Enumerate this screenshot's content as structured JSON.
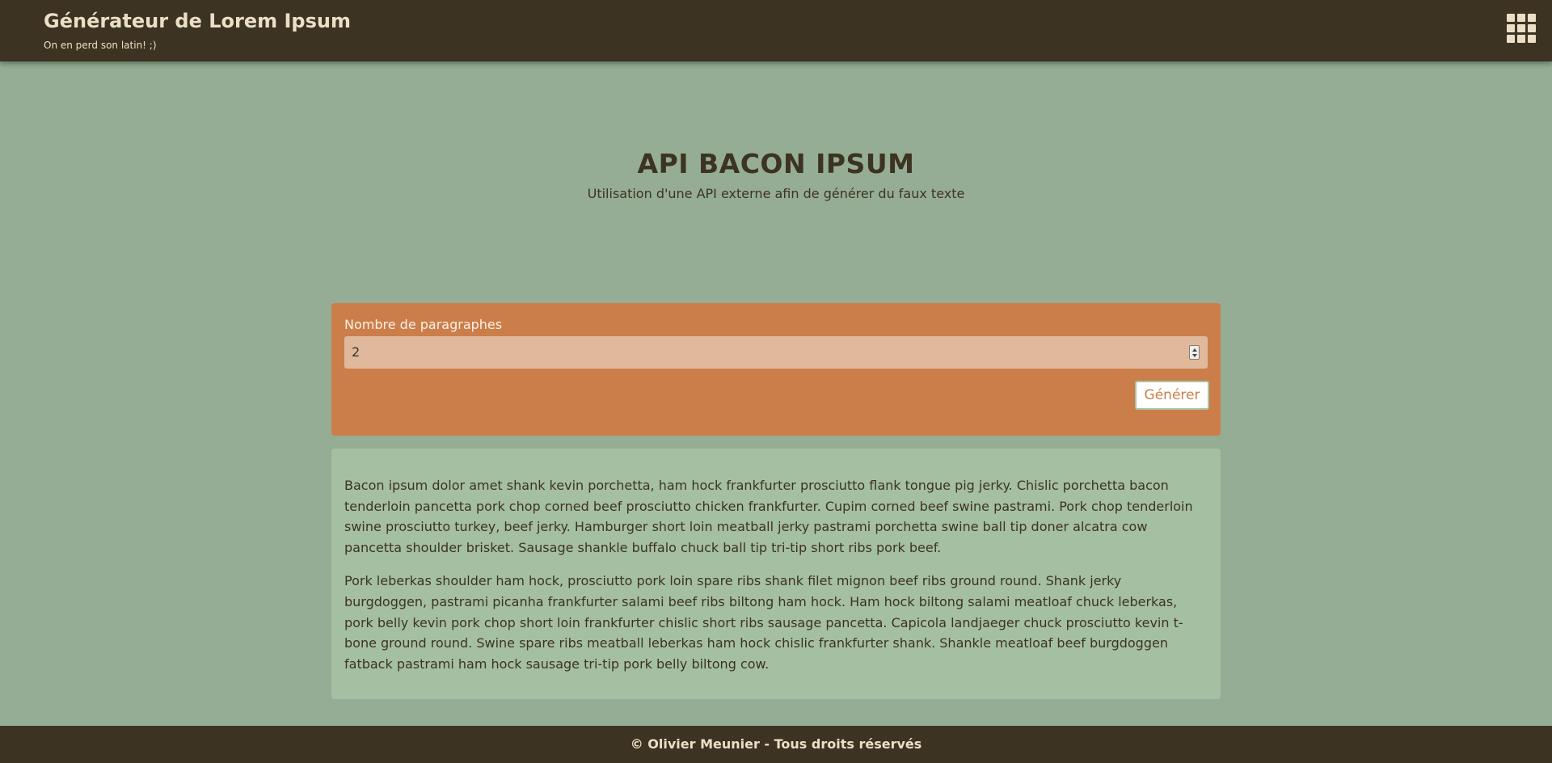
{
  "header": {
    "title": "Générateur de Lorem Ipsum",
    "subtitle": "On en perd son latin! ;)",
    "menu_icon": "grid-apps-icon"
  },
  "hero": {
    "title": "API BACON IPSUM",
    "subtitle": "Utilisation d'une API externe afin de générer du faux texte"
  },
  "form": {
    "label": "Nombre de paragraphes",
    "value": "2",
    "button_label": "Générer"
  },
  "result": {
    "paragraphs": [
      "Bacon ipsum dolor amet shank kevin porchetta, ham hock frankfurter prosciutto flank tongue pig jerky. Chislic porchetta bacon tenderloin pancetta pork chop corned beef prosciutto chicken frankfurter. Cupim corned beef swine pastrami. Pork chop tenderloin swine prosciutto turkey, beef jerky. Hamburger short loin meatball jerky pastrami porchetta swine ball tip doner alcatra cow pancetta shoulder brisket. Sausage shankle buffalo chuck ball tip tri-tip short ribs pork beef.",
      "Pork leberkas shoulder ham hock, prosciutto pork loin spare ribs shank filet mignon beef ribs ground round. Shank jerky burgdoggen, pastrami picanha frankfurter salami beef ribs biltong ham hock. Ham hock biltong salami meatloaf chuck leberkas, pork belly kevin pork chop short loin frankfurter chislic short ribs sausage pancetta. Capicola landjaeger chuck prosciutto kevin t-bone ground round. Swine spare ribs meatball leberkas ham hock chislic frankfurter shank. Shankle meatloaf beef burgdoggen fatback pastrami ham hock sausage tri-tip pork belly biltong cow."
    ]
  },
  "footer": {
    "text": "© Olivier Meunier - Tous droits réservés"
  },
  "colors": {
    "header_bg": "#3d3322",
    "page_bg": "#95ad94",
    "form_bg": "#cb7e4a",
    "input_bg": "#e0b99c",
    "result_bg": "#a5bfa3",
    "text_light": "#ecdfc6"
  }
}
